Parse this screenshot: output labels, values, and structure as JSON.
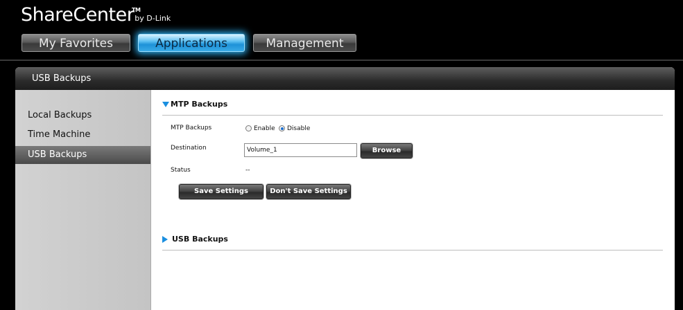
{
  "app": {
    "logo_main": "ShareCenter",
    "logo_tm": "TM",
    "logo_by": "by D-Link"
  },
  "tabs": [
    {
      "label": "My Favorites",
      "active": false
    },
    {
      "label": "Applications",
      "active": true
    },
    {
      "label": "Management",
      "active": false
    }
  ],
  "panel": {
    "title": "USB Backups"
  },
  "sidebar": {
    "items": [
      {
        "label": "Local Backups",
        "selected": false
      },
      {
        "label": "Time Machine",
        "selected": false
      },
      {
        "label": "USB Backups",
        "selected": true
      }
    ]
  },
  "mtp": {
    "section_title": "MTP Backups",
    "expanded": true,
    "mtp_label": "MTP Backups",
    "enable_label": "Enable",
    "disable_label": "Disable",
    "selected": "Disable",
    "destination_label": "Destination",
    "destination_value": "Volume_1",
    "browse_label": "Browse",
    "status_label": "Status",
    "status_value": "--",
    "save_label": "Save Settings",
    "dont_save_label": "Don't Save Settings"
  },
  "usb": {
    "section_title": "USB Backups",
    "expanded": false
  },
  "colors": {
    "accent": "#1a8fe0",
    "active_tab": "#2aa7e6"
  }
}
